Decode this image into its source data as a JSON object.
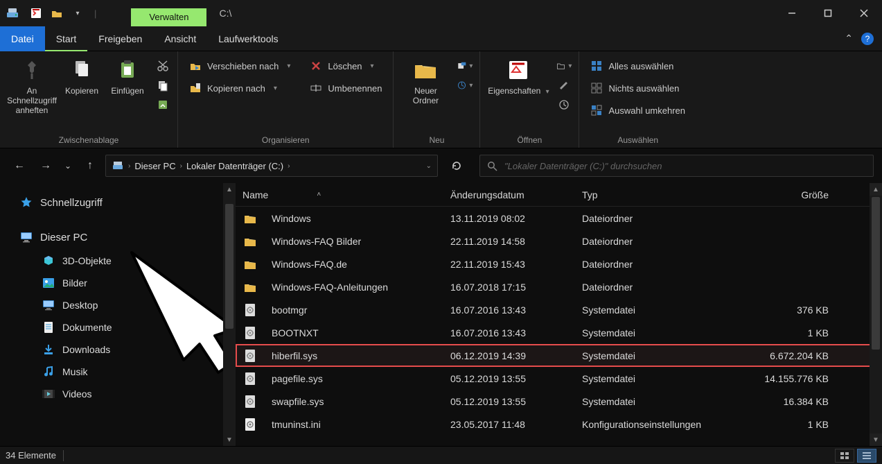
{
  "window": {
    "title_path": "C:\\",
    "context_tab": "Verwalten"
  },
  "ribbon_tabs": {
    "file": "Datei",
    "home": "Start",
    "share": "Freigeben",
    "view": "Ansicht",
    "drive_tools": "Laufwerktools"
  },
  "ribbon": {
    "clipboard": {
      "label": "Zwischenablage",
      "pin": "An Schnellzugriff anheften",
      "copy": "Kopieren",
      "paste": "Einfügen"
    },
    "organize": {
      "label": "Organisieren",
      "move_to": "Verschieben nach",
      "copy_to": "Kopieren nach",
      "delete": "Löschen",
      "rename": "Umbenennen"
    },
    "neu": {
      "label": "Neu",
      "new_folder": "Neuer Ordner"
    },
    "open": {
      "label": "Öffnen",
      "properties": "Eigenschaften"
    },
    "select": {
      "label": "Auswählen",
      "select_all": "Alles auswählen",
      "select_none": "Nichts auswählen",
      "invert": "Auswahl umkehren"
    }
  },
  "breadcrumb": {
    "root": "Dieser PC",
    "drive": "Lokaler Datenträger (C:)"
  },
  "search": {
    "placeholder": "\"Lokaler Datenträger (C:)\" durchsuchen"
  },
  "tree": {
    "quick_access": "Schnellzugriff",
    "this_pc": "Dieser PC",
    "children": [
      "3D-Objekte",
      "Bilder",
      "Desktop",
      "Dokumente",
      "Downloads",
      "Musik",
      "Videos"
    ]
  },
  "columns": {
    "name": "Name",
    "date": "Änderungsdatum",
    "type": "Typ",
    "size": "Größe"
  },
  "rows": [
    {
      "icon": "folder",
      "name": "Windows",
      "date": "13.11.2019 08:02",
      "type": "Dateiordner",
      "size": ""
    },
    {
      "icon": "folder",
      "name": "Windows-FAQ Bilder",
      "date": "22.11.2019 14:58",
      "type": "Dateiordner",
      "size": ""
    },
    {
      "icon": "folder",
      "name": "Windows-FAQ.de",
      "date": "22.11.2019 15:43",
      "type": "Dateiordner",
      "size": ""
    },
    {
      "icon": "folder",
      "name": "Windows-FAQ-Anleitungen",
      "date": "16.07.2018 17:15",
      "type": "Dateiordner",
      "size": ""
    },
    {
      "icon": "sys",
      "name": "bootmgr",
      "date": "16.07.2016 13:43",
      "type": "Systemdatei",
      "size": "376 KB"
    },
    {
      "icon": "sys",
      "name": "BOOTNXT",
      "date": "16.07.2016 13:43",
      "type": "Systemdatei",
      "size": "1 KB"
    },
    {
      "icon": "sys",
      "name": "hiberfil.sys",
      "date": "06.12.2019 14:39",
      "type": "Systemdatei",
      "size": "6.672.204 KB",
      "highlight": true
    },
    {
      "icon": "sys",
      "name": "pagefile.sys",
      "date": "05.12.2019 13:55",
      "type": "Systemdatei",
      "size": "14.155.776 KB"
    },
    {
      "icon": "sys",
      "name": "swapfile.sys",
      "date": "05.12.2019 13:55",
      "type": "Systemdatei",
      "size": "16.384 KB"
    },
    {
      "icon": "ini",
      "name": "tmuninst.ini",
      "date": "23.05.2017 11:48",
      "type": "Konfigurationseinstellungen",
      "size": "1 KB"
    }
  ],
  "status": {
    "count": "34 Elemente"
  }
}
